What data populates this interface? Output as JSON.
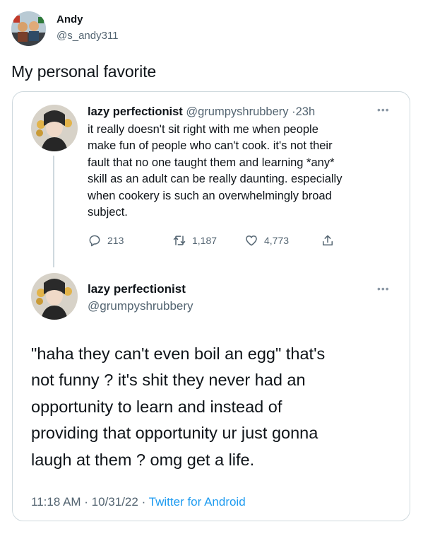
{
  "quoting_user": {
    "name": "Andy",
    "handle": "@s_andy311",
    "caption": "My personal favorite"
  },
  "reply_tweet": {
    "author_name": "lazy perfectionist",
    "author_handle": "@grumpyshrubbery",
    "time": "23h",
    "lines": [
      "it really doesn't sit right with me when people",
      "make fun of people who can't cook. it's not their",
      "fault that no one taught them and learning *any*",
      "skill as an adult can be really daunting. especially",
      "when cookery is such an overwhelmingly broad",
      "subject."
    ],
    "replies": "213",
    "retweets": "1,187",
    "likes": "4,773"
  },
  "main_tweet": {
    "author_name": "lazy perfectionist",
    "author_handle": "@grumpyshrubbery",
    "lines": [
      "\"haha they can't even boil an egg\" that's",
      "not funny ? it's shit they never had an",
      "opportunity to learn and instead of",
      "providing that opportunity ur just gonna",
      "laugh at them ? omg get a life."
    ],
    "timestamp": "11:18 AM · 10/31/22 · ",
    "source": "Twitter for Android"
  },
  "colors": {
    "accent": "#1d9bf0",
    "muted": "#536471",
    "border": "#cfd9de"
  }
}
